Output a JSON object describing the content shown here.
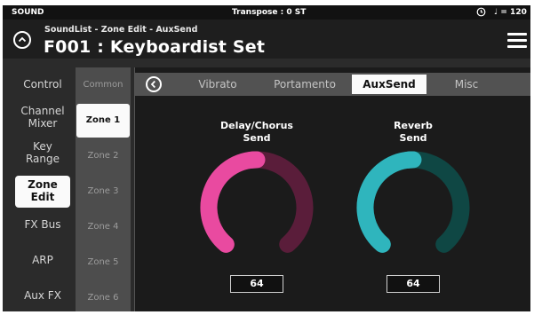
{
  "status_bar": {
    "mode": "SOUND",
    "transpose": "Transpose : 0 ST",
    "clock_icon": "clock-icon",
    "tempo": "♩ = 120"
  },
  "header": {
    "breadcrumb": "SoundList - Zone Edit - AuxSend",
    "title": "F001 : Keyboardist Set",
    "back_icon": "chevron-up-circle-icon",
    "menu_icon": "hamburger-menu-icon"
  },
  "categories": [
    {
      "label": "Control",
      "selected": false
    },
    {
      "label": "Channel\nMixer",
      "selected": false
    },
    {
      "label": "Key\nRange",
      "selected": false
    },
    {
      "label": "Zone\nEdit",
      "selected": true
    },
    {
      "label": "FX Bus",
      "selected": false
    },
    {
      "label": "ARP",
      "selected": false
    },
    {
      "label": "Aux FX",
      "selected": false
    }
  ],
  "zones": [
    {
      "label": "Common",
      "selected": false
    },
    {
      "label": "Zone 1",
      "selected": true
    },
    {
      "label": "Zone 2",
      "selected": false
    },
    {
      "label": "Zone 3",
      "selected": false
    },
    {
      "label": "Zone 4",
      "selected": false
    },
    {
      "label": "Zone 5",
      "selected": false
    },
    {
      "label": "Zone 6",
      "selected": false
    }
  ],
  "tabs": [
    {
      "label": "Vibrato",
      "selected": false
    },
    {
      "label": "Portamento",
      "selected": false
    },
    {
      "label": "AuxSend",
      "selected": true
    },
    {
      "label": "Misc",
      "selected": false
    }
  ],
  "knobs": [
    {
      "label_line1": "Delay/Chorus",
      "label_line2": "Send",
      "value": "64",
      "level": 0.5,
      "active_color": "#e94aa0",
      "track_color": "#5a1d3a"
    },
    {
      "label_line1": "Reverb",
      "label_line2": "Send",
      "value": "64",
      "level": 0.5,
      "active_color": "#2fb5bd",
      "track_color": "#0f4744"
    }
  ]
}
